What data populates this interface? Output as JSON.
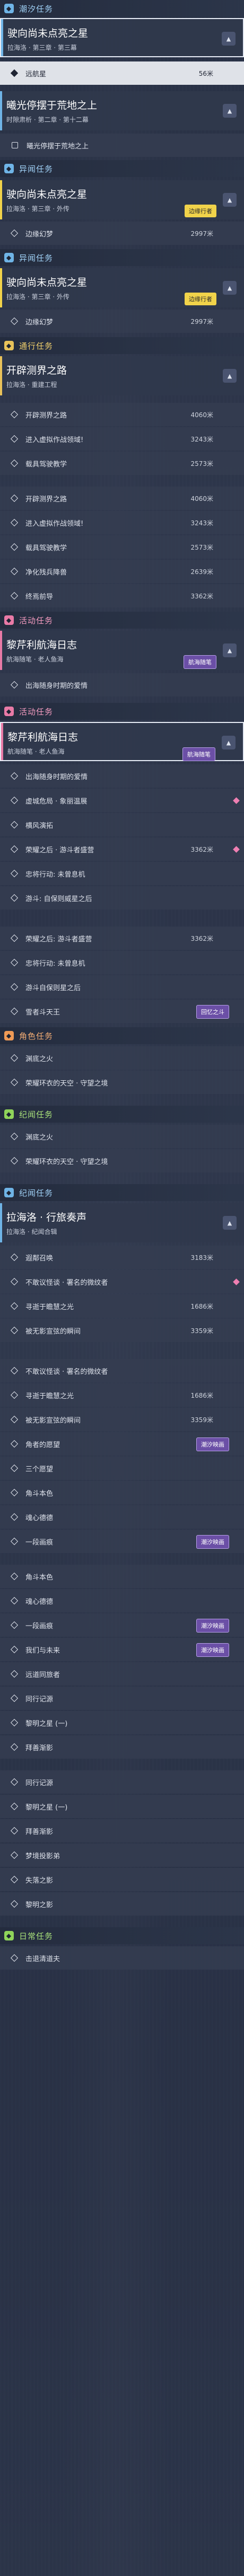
{
  "categories": {
    "chaoxi": "潮汐任务",
    "yiwen": "异闻任务",
    "tongxing": "通行任务",
    "huodong": "活动任务",
    "jiaose": "角色任务",
    "jiyuan": "纪闻任务",
    "rihuo": "日常任务"
  },
  "q1": {
    "title": "驶向尚未点亮之星",
    "sub": "拉海洛 · 第三章 · 第三幕",
    "step": "远航星",
    "dist": "56米"
  },
  "q2": {
    "title": "曦光停摆于荒地之上",
    "sub": "时隙肃析 · 第二章 · 第十二幕",
    "step": "曦光停摆于荒地之上"
  },
  "q3": {
    "title": "驶向尚未点亮之星",
    "sub": "拉海洛 · 第三章 · 外传",
    "tag": "边缘行者",
    "step": "边缘幻梦",
    "dist": "2997米"
  },
  "q4": {
    "title": "驶向尚未点亮之星",
    "sub": "拉海洛 · 第三章 · 外传",
    "tag": "边缘行者",
    "step": "边缘幻梦",
    "dist": "2997米"
  },
  "q5": {
    "title": "开辟测界之路",
    "sub": "拉海洛 · 重建工程"
  },
  "open_rows_a": [
    {
      "label": "开辟测界之路",
      "dist": "4060米"
    },
    {
      "label": "进入虚拟作战领域!",
      "dist": "3243米"
    },
    {
      "label": "载具驾驶教学",
      "dist": "2573米"
    }
  ],
  "open_rows_b": [
    {
      "label": "开辟测界之路",
      "dist": "4060米"
    },
    {
      "label": "进入虚拟作战领域!",
      "dist": "3243米"
    },
    {
      "label": "载具驾驶教学",
      "dist": "2573米"
    },
    {
      "label": "净化残兵降兽",
      "dist": "2639米"
    },
    {
      "label": "终焉前导",
      "dist": "3362米"
    }
  ],
  "q6": {
    "title": "黎芹利航海日志",
    "sub": "航海随笔 · 老人鱼海",
    "tag": "航海随笔",
    "step": "出海随身时期的爱情"
  },
  "q7": {
    "title": "黎芹利航海日志",
    "sub": "航海随笔 · 老人鱼海",
    "tag": "航海随笔"
  },
  "navi_rows": [
    {
      "label": "出海随身时期的爱情"
    },
    {
      "label": "虚城危局 · 象丽温展"
    },
    {
      "label": "横风演拓"
    },
    {
      "label": "荣耀之后 · 游斗者盛营",
      "dist": "3362米"
    },
    {
      "label": "忠将行动: 未曾息机"
    },
    {
      "label": "游斗: 自保则威星之后"
    }
  ],
  "extra_rows": [
    {
      "label": "荣耀之后: 游斗者盛营",
      "dist": "3362米"
    },
    {
      "label": "忠将行动: 未曾息机"
    },
    {
      "label": "游斗自保则星之后"
    },
    {
      "label": "雪者斗天王",
      "tag": "回忆之斗"
    }
  ],
  "role_rows": [
    {
      "label": "渊底之火"
    },
    {
      "label": "荣耀环衣的天空 · 守望之境"
    }
  ],
  "lore_rows": [
    {
      "label": "渊底之火"
    },
    {
      "label": "荣耀环衣的天空 · 守望之境"
    }
  ],
  "q8": {
    "title": "拉海洛 · 行旅奏声",
    "sub": "拉海洛 · 纪闻合辑",
    "tag": "纪闻"
  },
  "lore_list_a": [
    {
      "label": "遐鄰召唤",
      "dist": "3183米"
    },
    {
      "label": "不敢议怪谈 · 署名的微纹者"
    },
    {
      "label": "寻逝于瞻慧之光",
      "dist": "1686米"
    },
    {
      "label": "被无影宣弦的瞬间",
      "dist": "3359米"
    }
  ],
  "lore_list_b": [
    {
      "label": "不敢议怪谈 · 署名的微纹者"
    },
    {
      "label": "寻逝于瞻慧之光",
      "dist": "1686米"
    },
    {
      "label": "被无影宣弦的瞬间",
      "dist": "3359米"
    },
    {
      "label": "角者的愿望",
      "tag": "潮汐映画"
    },
    {
      "label": "三个愿望"
    },
    {
      "label": "角斗本色"
    },
    {
      "label": "魂心德德"
    },
    {
      "label": "一段画痕",
      "tag": "潮汐映画"
    }
  ],
  "misc_rows": [
    {
      "label": "角斗本色"
    },
    {
      "label": "魂心德德"
    },
    {
      "label": "一段画痕",
      "tag": "潮汐映画"
    },
    {
      "label": "我们与未来",
      "tag": "潮汐映画"
    },
    {
      "label": "远道同旅者"
    },
    {
      "label": "同行记源"
    },
    {
      "label": "黎明之星 (一)"
    },
    {
      "label": "拜善渐影"
    }
  ],
  "tail_rows": [
    {
      "label": "同行记源"
    },
    {
      "label": "黎明之星 (一)"
    },
    {
      "label": "拜善渐影"
    },
    {
      "label": "梦境投影弟"
    },
    {
      "label": "失落之影"
    },
    {
      "label": "黎明之影"
    }
  ],
  "daily_rows": [
    {
      "label": "击退清道夫"
    }
  ]
}
